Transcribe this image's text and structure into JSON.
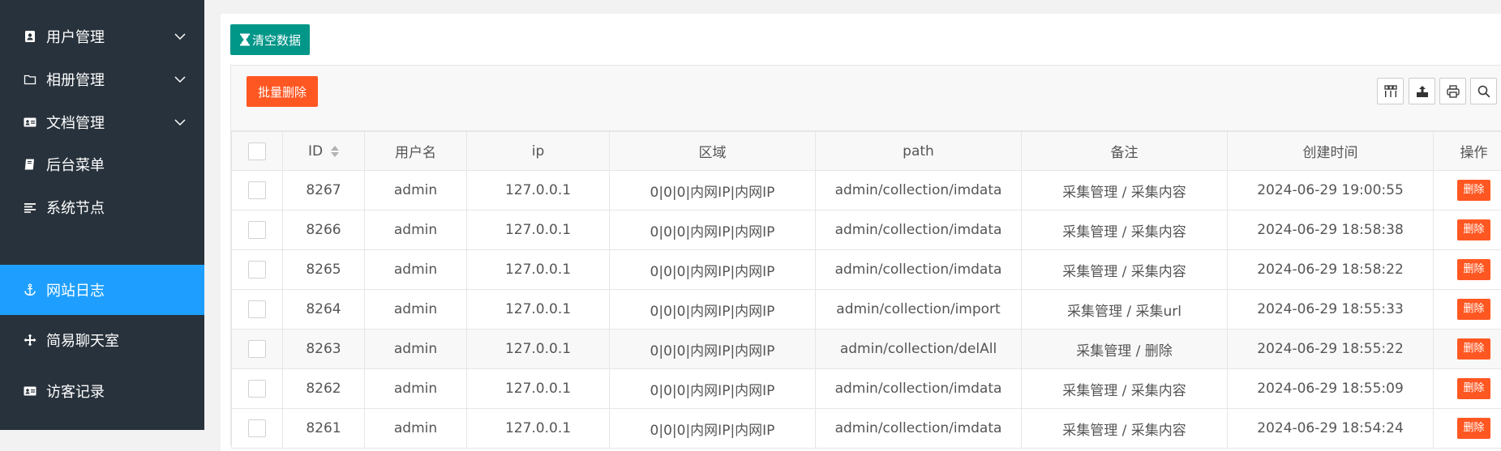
{
  "sidebar": {
    "items": [
      {
        "label": "用户管理",
        "icon": "address-book-icon",
        "has_chevron": true
      },
      {
        "label": "相册管理",
        "icon": "folder-icon",
        "has_chevron": true
      },
      {
        "label": "文档管理",
        "icon": "id-card-icon",
        "has_chevron": true
      },
      {
        "label": "后台菜单",
        "icon": "book-icon",
        "has_chevron": false
      },
      {
        "label": "系统节点",
        "icon": "align-left-icon",
        "has_chevron": false
      },
      {
        "label": "网站日志",
        "icon": "anchor-icon",
        "has_chevron": false,
        "active": true
      },
      {
        "label": "简易聊天室",
        "icon": "arrows-icon",
        "has_chevron": false
      },
      {
        "label": "访客记录",
        "icon": "id-card-icon",
        "has_chevron": false
      }
    ],
    "bg_color": "#28323c",
    "active_color": "#1e9fff"
  },
  "main": {
    "clear_button_label": "清空数据",
    "batch_delete_label": "批量删除",
    "toolbar_icons": [
      "columns-icon",
      "export-icon",
      "print-icon",
      "search-icon"
    ]
  },
  "table": {
    "headers": {
      "id": "ID",
      "user": "用户名",
      "ip": "ip",
      "region": "区域",
      "path": "path",
      "note": "备注",
      "created": "创建时间",
      "action": "操作"
    },
    "delete_label": "删除",
    "rows": [
      {
        "id": "8267",
        "user": "admin",
        "ip": "127.0.0.1",
        "region": "0|0|0|内网IP|内网IP",
        "path": "admin/collection/imdata",
        "note": "采集管理 / 采集内容",
        "created": "2024-06-29 19:00:55"
      },
      {
        "id": "8266",
        "user": "admin",
        "ip": "127.0.0.1",
        "region": "0|0|0|内网IP|内网IP",
        "path": "admin/collection/imdata",
        "note": "采集管理 / 采集内容",
        "created": "2024-06-29 18:58:38"
      },
      {
        "id": "8265",
        "user": "admin",
        "ip": "127.0.0.1",
        "region": "0|0|0|内网IP|内网IP",
        "path": "admin/collection/imdata",
        "note": "采集管理 / 采集内容",
        "created": "2024-06-29 18:58:22"
      },
      {
        "id": "8264",
        "user": "admin",
        "ip": "127.0.0.1",
        "region": "0|0|0|内网IP|内网IP",
        "path": "admin/collection/import",
        "note": "采集管理 / 采集url",
        "created": "2024-06-29 18:55:33"
      },
      {
        "id": "8263",
        "user": "admin",
        "ip": "127.0.0.1",
        "region": "0|0|0|内网IP|内网IP",
        "path": "admin/collection/delAll",
        "note": "采集管理 / 删除",
        "created": "2024-06-29 18:55:22"
      },
      {
        "id": "8262",
        "user": "admin",
        "ip": "127.0.0.1",
        "region": "0|0|0|内网IP|内网IP",
        "path": "admin/collection/imdata",
        "note": "采集管理 / 采集内容",
        "created": "2024-06-29 18:55:09"
      },
      {
        "id": "8261",
        "user": "admin",
        "ip": "127.0.0.1",
        "region": "0|0|0|内网IP|内网IP",
        "path": "admin/collection/imdata",
        "note": "采集管理 / 采集内容",
        "created": "2024-06-29 18:54:24"
      }
    ]
  }
}
